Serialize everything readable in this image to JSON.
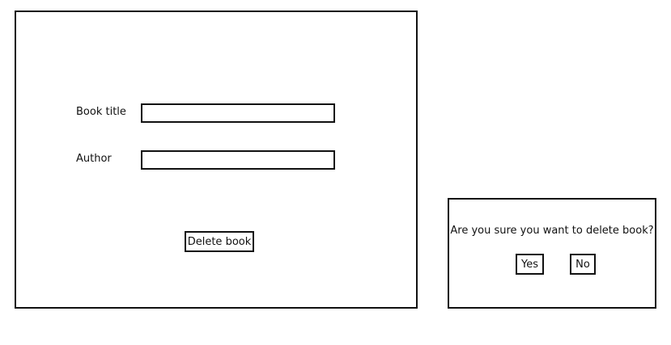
{
  "form": {
    "book_title_label": "Book title",
    "book_title_value": "",
    "author_label": "Author",
    "author_value": "",
    "delete_button_label": "Delete book"
  },
  "dialog": {
    "question": "Are you sure you want to delete book?",
    "yes_label": "Yes",
    "no_label": "No"
  }
}
